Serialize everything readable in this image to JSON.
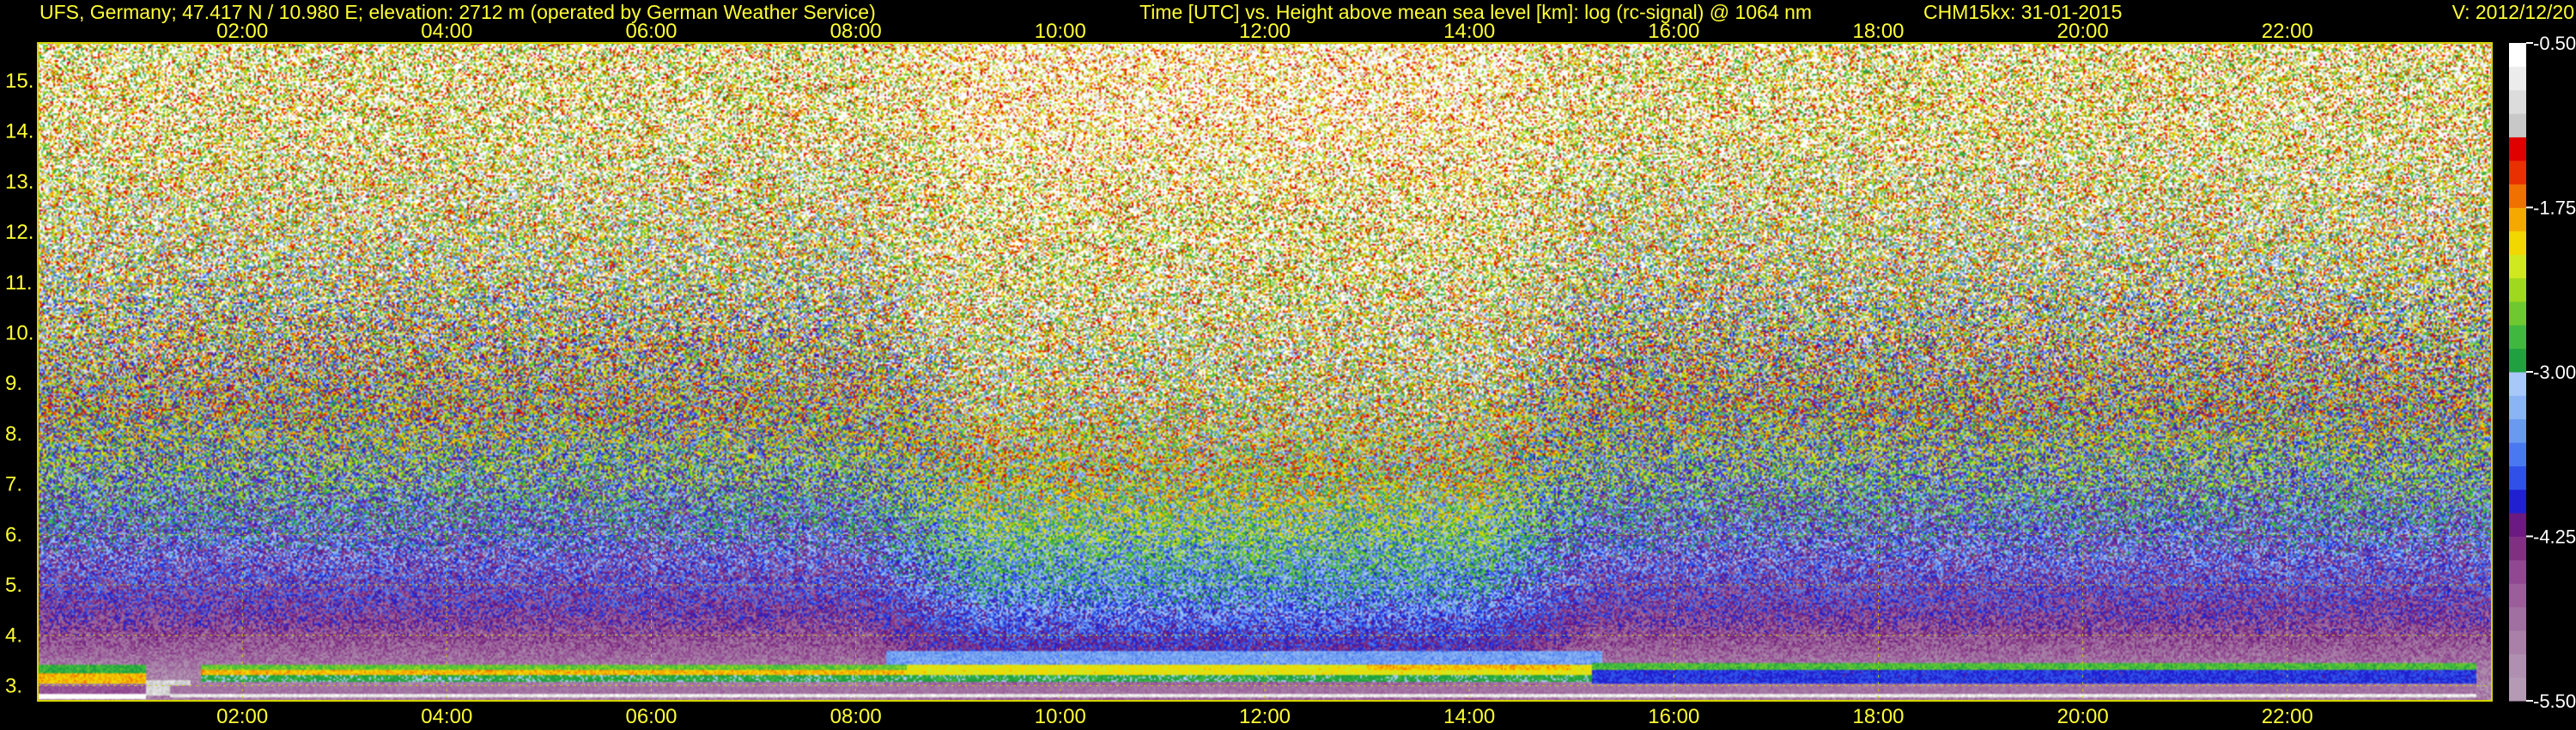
{
  "header": {
    "station": "UFS, Germany; 47.417 N / 10.980 E; elevation: 2712 m  (operated by German Weather Service)",
    "description": "Time [UTC] vs. Height above mean sea level [km]: log (rc-signal) @ 1064 nm",
    "instrument": "CHM15kx: 31-01-2015",
    "version": "V: 2012/12/20"
  },
  "colors": {
    "text": "#ffff33",
    "grid": "#d4d400",
    "background": "#000000"
  },
  "chart_data": {
    "type": "heatmap",
    "x_axis": {
      "unit": "hours UTC",
      "range": [
        0.0,
        24.0
      ],
      "ticks": [
        2,
        4,
        6,
        8,
        10,
        12,
        14,
        16,
        18,
        20,
        22
      ],
      "tick_labels": [
        "02:00",
        "04:00",
        "06:00",
        "08:00",
        "10:00",
        "12:00",
        "14:00",
        "16:00",
        "18:00",
        "20:00",
        "22:00"
      ]
    },
    "y_axis": {
      "unit": "km",
      "range": [
        2.7,
        15.75
      ],
      "ticks": [
        3,
        4,
        5,
        6,
        7,
        8,
        9,
        10,
        11,
        12,
        13,
        14,
        15
      ],
      "tick_labels": [
        "3.",
        "4.",
        "5.",
        "6.",
        "7.",
        "8.",
        "9.",
        "10.",
        "11.",
        "12.",
        "13.",
        "14.",
        "15."
      ]
    },
    "grid": true,
    "colorbar": {
      "range": [
        -5.5,
        -0.5
      ],
      "ticks": [
        -0.5,
        -1.75,
        -3.0,
        -4.25,
        -5.5
      ],
      "tick_labels": [
        "-0.50",
        "-1.75",
        "-3.00",
        "-4.25",
        "-5.50"
      ],
      "colors": [
        "#b49ab4",
        "#b090b0",
        "#a880a8",
        "#a070a0",
        "#9a5e9a",
        "#904890",
        "#803080",
        "#6a1a82",
        "#2020d0",
        "#3050e8",
        "#4a78f0",
        "#6a9af0",
        "#8ab4f4",
        "#a8c8f8",
        "#20a040",
        "#40b840",
        "#70c830",
        "#a0d820",
        "#d0e820",
        "#f0d800",
        "#f4a800",
        "#f07000",
        "#e83000",
        "#e00000",
        "#c8c8c8",
        "#dcdcdc",
        "#ececec",
        "#ffffff"
      ]
    },
    "layers": [
      {
        "hours": [
          0.0,
          1.05
        ],
        "km": [
          2.72,
          2.84
        ],
        "level": -0.5
      },
      {
        "hours": [
          0.0,
          1.05
        ],
        "km": [
          2.84,
          3.0
        ],
        "level": -4.6
      },
      {
        "hours": [
          0.0,
          1.05
        ],
        "km": [
          3.05,
          3.24
        ],
        "level": -1.9
      },
      {
        "hours": [
          0.0,
          1.05
        ],
        "km": [
          3.24,
          3.42
        ],
        "level": -2.8
      },
      {
        "hours": [
          1.05,
          1.5
        ],
        "km": [
          2.8,
          3.1
        ],
        "level": -1.0
      },
      {
        "hours": [
          1.3,
          23.85
        ],
        "km": [
          2.78,
          2.85
        ],
        "level": -0.8
      },
      {
        "hours": [
          1.3,
          23.85
        ],
        "km": [
          2.85,
          3.0
        ],
        "level": -4.9
      },
      {
        "hours": [
          1.6,
          15.2
        ],
        "km": [
          3.08,
          3.2
        ],
        "level": -2.9
      },
      {
        "hours": [
          1.6,
          8.5
        ],
        "km": [
          3.2,
          3.32
        ],
        "level": -1.9
      },
      {
        "hours": [
          1.6,
          15.2
        ],
        "km": [
          3.32,
          3.42
        ],
        "level": -2.6
      },
      {
        "hours": [
          8.5,
          15.2
        ],
        "km": [
          3.2,
          3.4
        ],
        "level": -2.1
      },
      {
        "hours": [
          13.0,
          15.0
        ],
        "km": [
          3.3,
          3.5
        ],
        "level": -1.9
      },
      {
        "hours": [
          8.3,
          15.3
        ],
        "km": [
          3.42,
          3.7
        ],
        "level": -3.4
      },
      {
        "hours": [
          15.2,
          23.85
        ],
        "km": [
          3.05,
          3.3
        ],
        "level": -3.9
      },
      {
        "hours": [
          15.2,
          23.85
        ],
        "km": [
          3.3,
          3.45
        ],
        "level": -2.7
      }
    ]
  }
}
